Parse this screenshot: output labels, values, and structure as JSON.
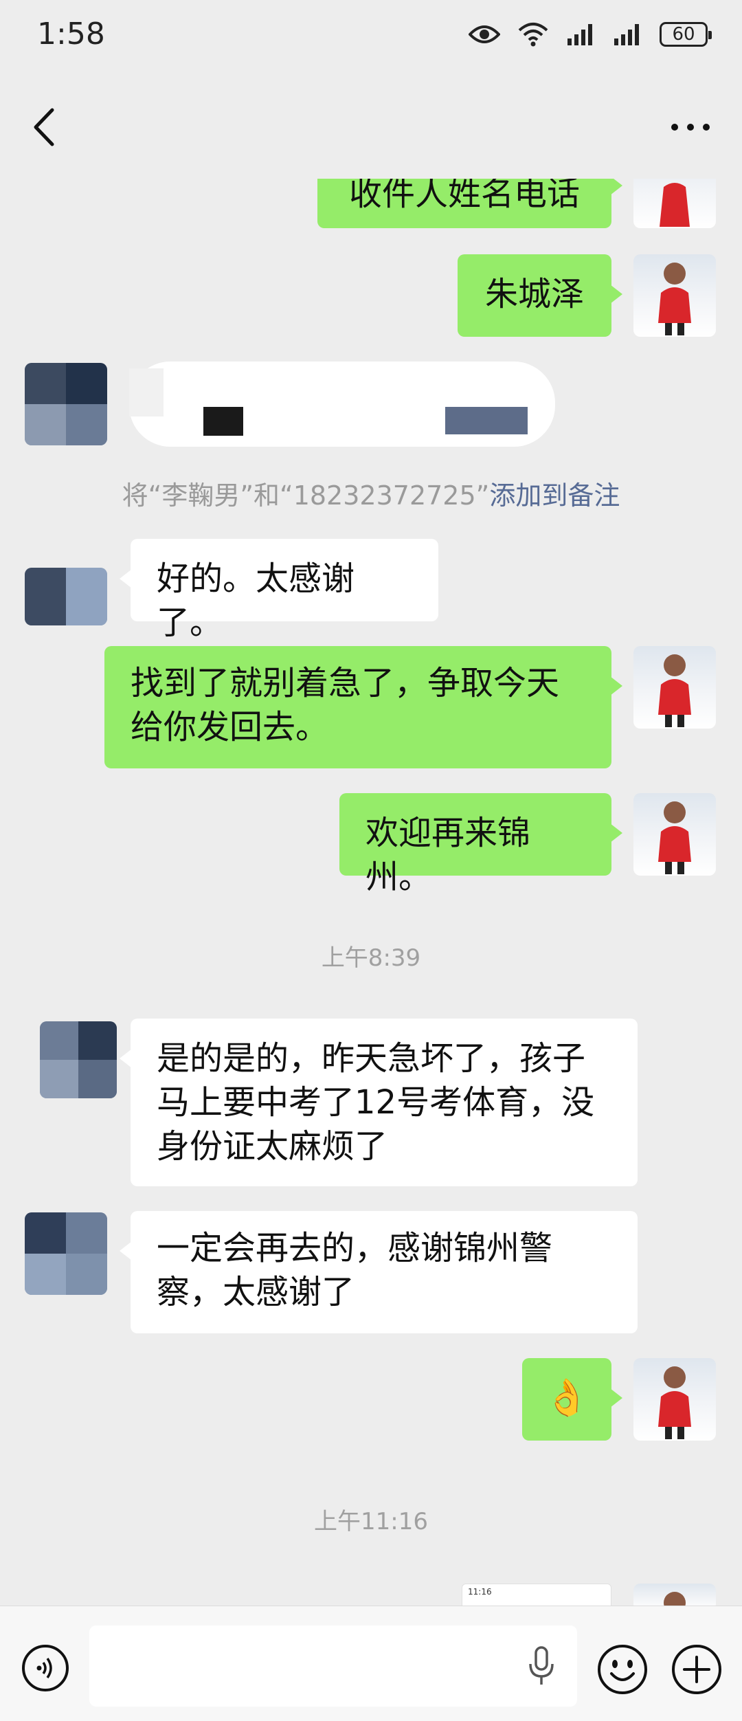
{
  "status_bar": {
    "time": "1:58",
    "battery": "60"
  },
  "messages": {
    "m1": "收件人姓名电话",
    "m2": "朱城泽",
    "m4": "好的。太感谢了。",
    "m5": "找到了就别着急了，争取今天给你发回去。",
    "m6": "欢迎再来锦州。",
    "m7": "是的是的，昨天急坏了，孩子马上要中考了12号考体育，没身份证太麻烦了",
    "m8": "一定会再去的，感谢锦州警察，太感谢了",
    "m9_emoji": "👌"
  },
  "system_note": {
    "prefix": "将“李鞠男”和“18232372725”",
    "link": "添加到备注"
  },
  "timestamps": {
    "t1": "上午8:39",
    "t2": "上午11:16"
  },
  "shared_screenshot": {
    "time": "11:16"
  },
  "icons": {
    "back": "chevron-left-icon",
    "more": "more-dots-icon",
    "voice": "voice-icon",
    "mic": "microphone-icon",
    "emoji": "emoji-icon",
    "plus": "plus-icon"
  },
  "colors": {
    "outgoing_bubble": "#95ec69",
    "incoming_bubble": "#ffffff",
    "background": "#ededed",
    "link": "#576b95"
  }
}
